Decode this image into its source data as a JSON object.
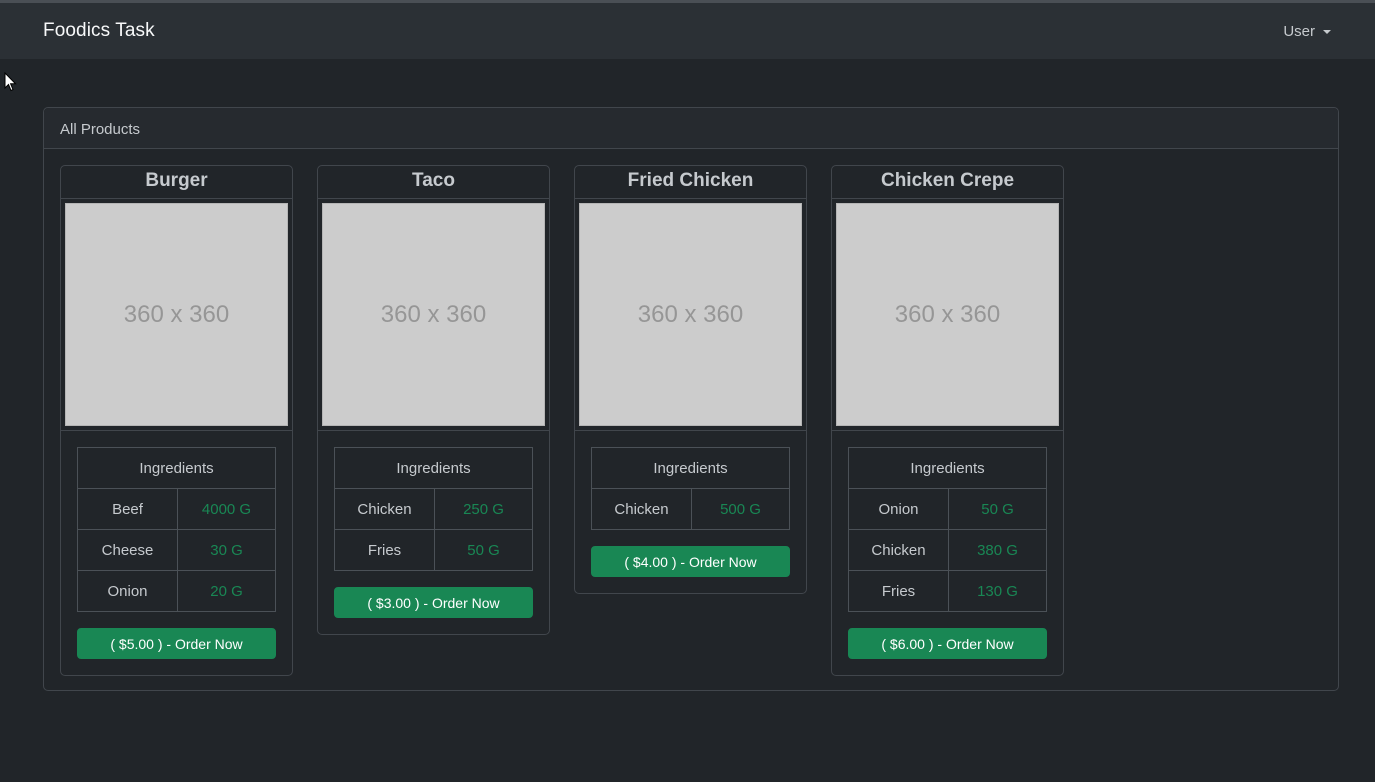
{
  "navbar": {
    "brand": "Foodics Task",
    "user_menu_label": "User"
  },
  "panel": {
    "title": "All Products"
  },
  "products": [
    {
      "name": "Burger",
      "image_label": "360 x 360",
      "ingredients_header": "Ingredients",
      "ingredients": [
        {
          "name": "Beef",
          "qty": "4000 G"
        },
        {
          "name": "Cheese",
          "qty": "30 G"
        },
        {
          "name": "Onion",
          "qty": "20 G"
        }
      ],
      "order_label": "( $5.00 ) - Order Now"
    },
    {
      "name": "Taco",
      "image_label": "360 x 360",
      "ingredients_header": "Ingredients",
      "ingredients": [
        {
          "name": "Chicken",
          "qty": "250 G"
        },
        {
          "name": "Fries",
          "qty": "50 G"
        }
      ],
      "order_label": "( $3.00 ) - Order Now"
    },
    {
      "name": "Fried Chicken",
      "image_label": "360 x 360",
      "ingredients_header": "Ingredients",
      "ingredients": [
        {
          "name": "Chicken",
          "qty": "500 G"
        }
      ],
      "order_label": "( $4.00 ) - Order Now"
    },
    {
      "name": "Chicken Crepe",
      "image_label": "360 x 360",
      "ingredients_header": "Ingredients",
      "ingredients": [
        {
          "name": "Onion",
          "qty": "50 G"
        },
        {
          "name": "Chicken",
          "qty": "380 G"
        },
        {
          "name": "Fries",
          "qty": "130 G"
        }
      ],
      "order_label": "( $6.00 ) - Order Now"
    }
  ],
  "colors": {
    "background": "#212529",
    "navbar": "#2b3035",
    "accent_green": "#198754",
    "border": "#41464c"
  }
}
